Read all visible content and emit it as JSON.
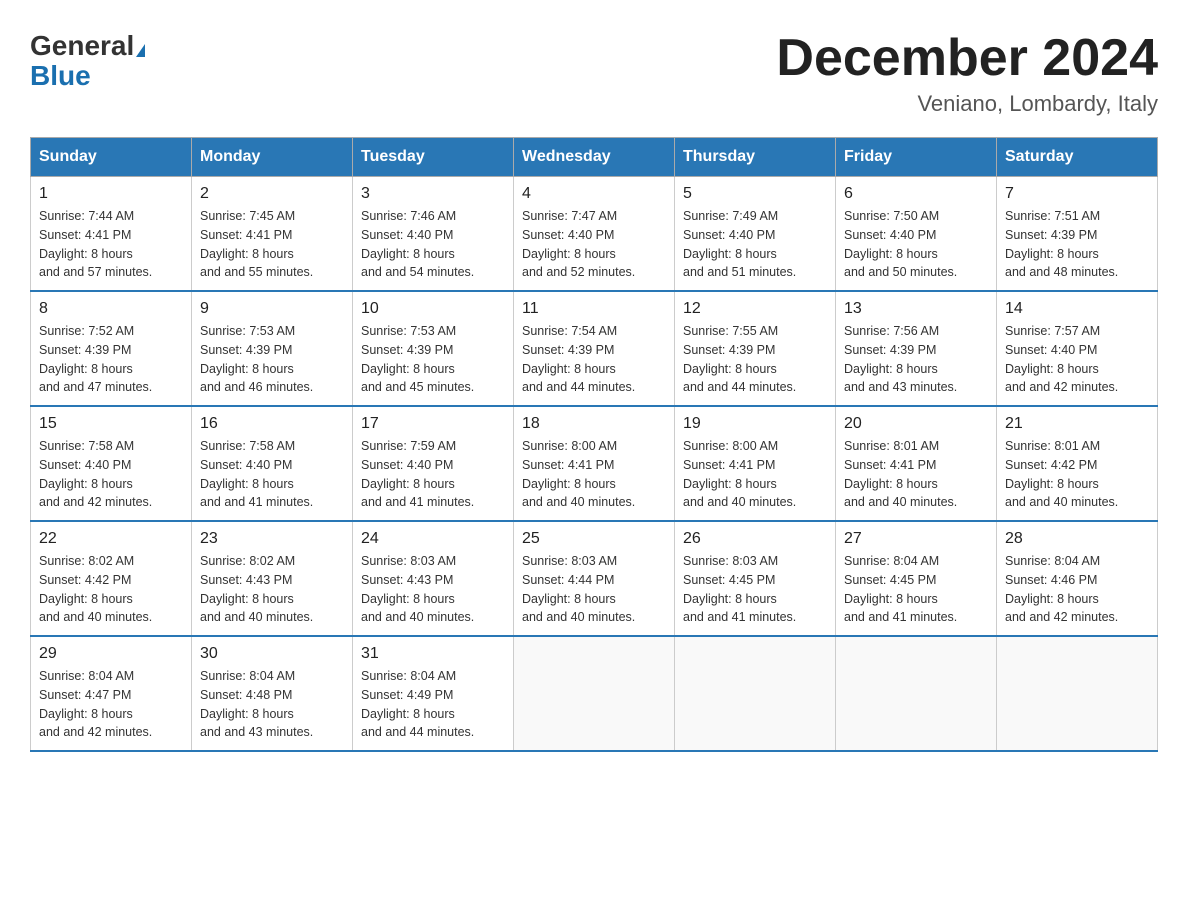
{
  "logo": {
    "general": "General",
    "triangle_symbol": "▲",
    "blue": "Blue"
  },
  "title": "December 2024",
  "location": "Veniano, Lombardy, Italy",
  "days_of_week": [
    "Sunday",
    "Monday",
    "Tuesday",
    "Wednesday",
    "Thursday",
    "Friday",
    "Saturday"
  ],
  "weeks": [
    [
      {
        "day": "1",
        "sunrise": "7:44 AM",
        "sunset": "4:41 PM",
        "daylight": "8 hours and 57 minutes."
      },
      {
        "day": "2",
        "sunrise": "7:45 AM",
        "sunset": "4:41 PM",
        "daylight": "8 hours and 55 minutes."
      },
      {
        "day": "3",
        "sunrise": "7:46 AM",
        "sunset": "4:40 PM",
        "daylight": "8 hours and 54 minutes."
      },
      {
        "day": "4",
        "sunrise": "7:47 AM",
        "sunset": "4:40 PM",
        "daylight": "8 hours and 52 minutes."
      },
      {
        "day": "5",
        "sunrise": "7:49 AM",
        "sunset": "4:40 PM",
        "daylight": "8 hours and 51 minutes."
      },
      {
        "day": "6",
        "sunrise": "7:50 AM",
        "sunset": "4:40 PM",
        "daylight": "8 hours and 50 minutes."
      },
      {
        "day": "7",
        "sunrise": "7:51 AM",
        "sunset": "4:39 PM",
        "daylight": "8 hours and 48 minutes."
      }
    ],
    [
      {
        "day": "8",
        "sunrise": "7:52 AM",
        "sunset": "4:39 PM",
        "daylight": "8 hours and 47 minutes."
      },
      {
        "day": "9",
        "sunrise": "7:53 AM",
        "sunset": "4:39 PM",
        "daylight": "8 hours and 46 minutes."
      },
      {
        "day": "10",
        "sunrise": "7:53 AM",
        "sunset": "4:39 PM",
        "daylight": "8 hours and 45 minutes."
      },
      {
        "day": "11",
        "sunrise": "7:54 AM",
        "sunset": "4:39 PM",
        "daylight": "8 hours and 44 minutes."
      },
      {
        "day": "12",
        "sunrise": "7:55 AM",
        "sunset": "4:39 PM",
        "daylight": "8 hours and 44 minutes."
      },
      {
        "day": "13",
        "sunrise": "7:56 AM",
        "sunset": "4:39 PM",
        "daylight": "8 hours and 43 minutes."
      },
      {
        "day": "14",
        "sunrise": "7:57 AM",
        "sunset": "4:40 PM",
        "daylight": "8 hours and 42 minutes."
      }
    ],
    [
      {
        "day": "15",
        "sunrise": "7:58 AM",
        "sunset": "4:40 PM",
        "daylight": "8 hours and 42 minutes."
      },
      {
        "day": "16",
        "sunrise": "7:58 AM",
        "sunset": "4:40 PM",
        "daylight": "8 hours and 41 minutes."
      },
      {
        "day": "17",
        "sunrise": "7:59 AM",
        "sunset": "4:40 PM",
        "daylight": "8 hours and 41 minutes."
      },
      {
        "day": "18",
        "sunrise": "8:00 AM",
        "sunset": "4:41 PM",
        "daylight": "8 hours and 40 minutes."
      },
      {
        "day": "19",
        "sunrise": "8:00 AM",
        "sunset": "4:41 PM",
        "daylight": "8 hours and 40 minutes."
      },
      {
        "day": "20",
        "sunrise": "8:01 AM",
        "sunset": "4:41 PM",
        "daylight": "8 hours and 40 minutes."
      },
      {
        "day": "21",
        "sunrise": "8:01 AM",
        "sunset": "4:42 PM",
        "daylight": "8 hours and 40 minutes."
      }
    ],
    [
      {
        "day": "22",
        "sunrise": "8:02 AM",
        "sunset": "4:42 PM",
        "daylight": "8 hours and 40 minutes."
      },
      {
        "day": "23",
        "sunrise": "8:02 AM",
        "sunset": "4:43 PM",
        "daylight": "8 hours and 40 minutes."
      },
      {
        "day": "24",
        "sunrise": "8:03 AM",
        "sunset": "4:43 PM",
        "daylight": "8 hours and 40 minutes."
      },
      {
        "day": "25",
        "sunrise": "8:03 AM",
        "sunset": "4:44 PM",
        "daylight": "8 hours and 40 minutes."
      },
      {
        "day": "26",
        "sunrise": "8:03 AM",
        "sunset": "4:45 PM",
        "daylight": "8 hours and 41 minutes."
      },
      {
        "day": "27",
        "sunrise": "8:04 AM",
        "sunset": "4:45 PM",
        "daylight": "8 hours and 41 minutes."
      },
      {
        "day": "28",
        "sunrise": "8:04 AM",
        "sunset": "4:46 PM",
        "daylight": "8 hours and 42 minutes."
      }
    ],
    [
      {
        "day": "29",
        "sunrise": "8:04 AM",
        "sunset": "4:47 PM",
        "daylight": "8 hours and 42 minutes."
      },
      {
        "day": "30",
        "sunrise": "8:04 AM",
        "sunset": "4:48 PM",
        "daylight": "8 hours and 43 minutes."
      },
      {
        "day": "31",
        "sunrise": "8:04 AM",
        "sunset": "4:49 PM",
        "daylight": "8 hours and 44 minutes."
      },
      null,
      null,
      null,
      null
    ]
  ],
  "labels": {
    "sunrise_prefix": "Sunrise: ",
    "sunset_prefix": "Sunset: ",
    "daylight_prefix": "Daylight: "
  }
}
